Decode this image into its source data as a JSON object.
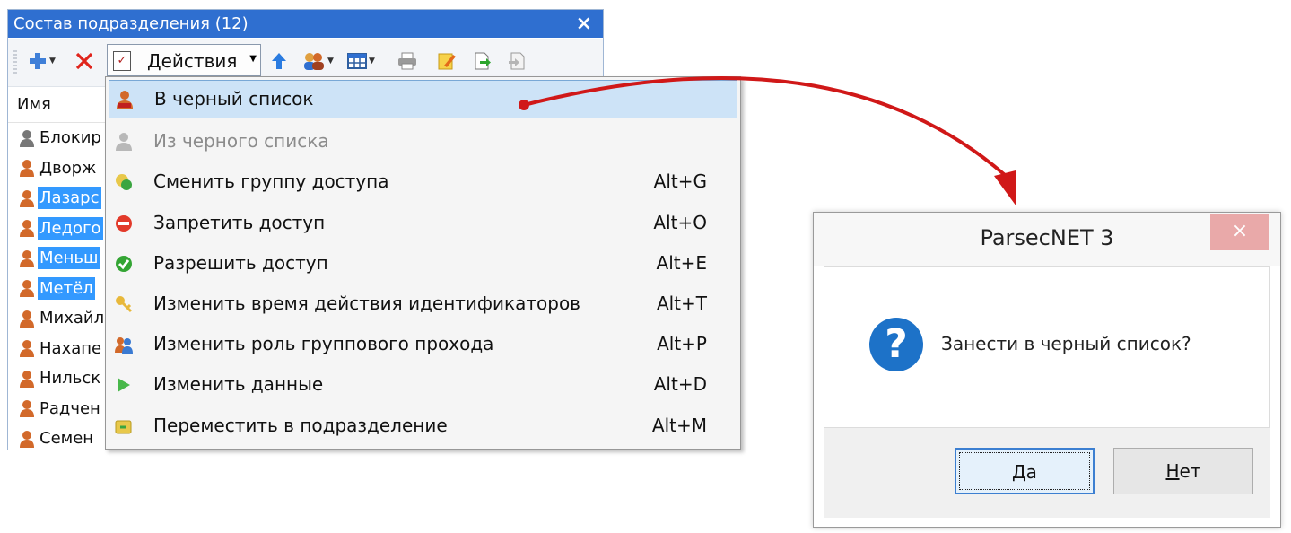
{
  "panel": {
    "title": "Состав подразделения (12)",
    "close": "×",
    "toolbar": {
      "actions_label": "Действия"
    },
    "column_header": "Имя",
    "rows": [
      {
        "name": "Блокир",
        "selected": false,
        "color": "#777777"
      },
      {
        "name": "Дворж",
        "selected": false,
        "color": "#d2692a"
      },
      {
        "name": "Лазарс",
        "selected": true,
        "color": "#d2692a"
      },
      {
        "name": "Ледого",
        "selected": true,
        "color": "#d2692a"
      },
      {
        "name": "Меньш",
        "selected": true,
        "color": "#d2692a"
      },
      {
        "name": "Метёл",
        "selected": true,
        "color": "#d2692a"
      },
      {
        "name": "Михайл",
        "selected": false,
        "color": "#d2692a"
      },
      {
        "name": "Нахапе",
        "selected": false,
        "color": "#d2692a"
      },
      {
        "name": "Нильск",
        "selected": false,
        "color": "#d2692a"
      },
      {
        "name": "Радчен",
        "selected": false,
        "color": "#d2692a"
      },
      {
        "name": "Семен",
        "selected": false,
        "color": "#d2692a"
      }
    ]
  },
  "menu": {
    "items": [
      {
        "label": "В черный список",
        "shortcut": "",
        "icon": "blacklist-person-icon",
        "highlighted": true,
        "disabled": false
      },
      {
        "label": "Из черного списка",
        "shortcut": "",
        "icon": "unblacklist-person-icon",
        "highlighted": false,
        "disabled": true
      },
      {
        "label": "Сменить группу доступа",
        "shortcut": "Alt+G",
        "icon": "access-group-icon",
        "highlighted": false,
        "disabled": false
      },
      {
        "label": "Запретить доступ",
        "shortcut": "Alt+O",
        "icon": "deny-access-icon",
        "highlighted": false,
        "disabled": false
      },
      {
        "label": "Разрешить доступ",
        "shortcut": "Alt+E",
        "icon": "allow-access-icon",
        "highlighted": false,
        "disabled": false
      },
      {
        "label": "Изменить время действия идентификаторов",
        "shortcut": "Alt+T",
        "icon": "key-time-icon",
        "highlighted": false,
        "disabled": false
      },
      {
        "label": "Изменить роль группового прохода",
        "shortcut": "Alt+P",
        "icon": "group-pass-icon",
        "highlighted": false,
        "disabled": false
      },
      {
        "label": "Изменить данные",
        "shortcut": "Alt+D",
        "icon": "edit-data-icon",
        "highlighted": false,
        "disabled": false
      },
      {
        "label": "Переместить в подразделение",
        "shortcut": "Alt+M",
        "icon": "move-department-icon",
        "highlighted": false,
        "disabled": false
      }
    ]
  },
  "dialog": {
    "title": "ParsecNET 3",
    "close": "×",
    "message": "Занести в черный список?",
    "yes_mnemonic": "Д",
    "yes_rest": "а",
    "no_mnemonic": "Н",
    "no_rest": "ет"
  },
  "colors": {
    "titlebar": "#2f6fd0",
    "selection": "#3399ff",
    "menu_highlight": "#cde3f7",
    "arrow": "#d01818",
    "question_icon": "#1d72c8"
  }
}
